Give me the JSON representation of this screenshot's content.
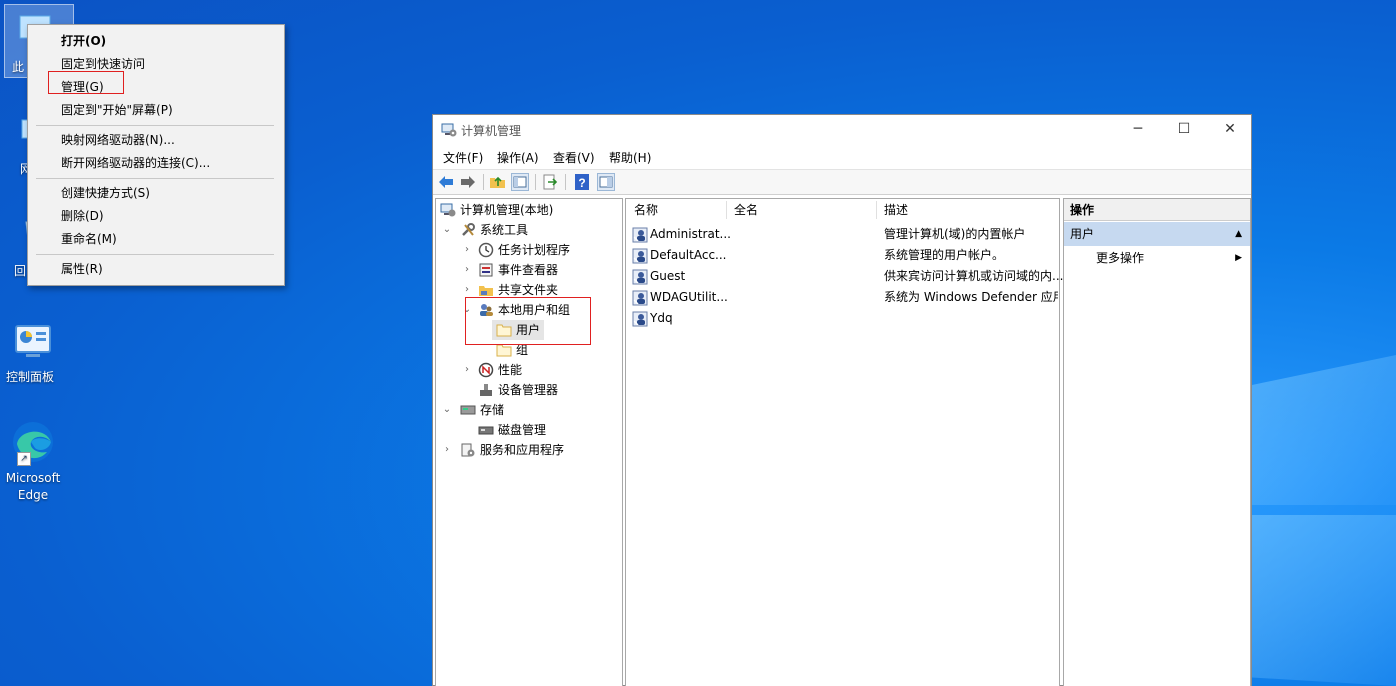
{
  "desktop": {
    "icons": [
      {
        "label": "此"
      },
      {
        "label": "网"
      },
      {
        "label": "回"
      },
      {
        "label": "控制面板"
      },
      {
        "label": "Microsoft Edge"
      }
    ]
  },
  "context_menu": {
    "items": [
      {
        "label": "打开(O)"
      },
      {
        "label": "固定到快速访问"
      },
      {
        "label": "管理(G)"
      },
      {
        "label": "固定到\"开始\"屏幕(P)"
      },
      {
        "label": "映射网络驱动器(N)..."
      },
      {
        "label": "断开网络驱动器的连接(C)..."
      },
      {
        "label": "创建快捷方式(S)"
      },
      {
        "label": "删除(D)"
      },
      {
        "label": "重命名(M)"
      },
      {
        "label": "属性(R)"
      }
    ]
  },
  "window": {
    "title": "计算机管理",
    "menu": [
      "文件(F)",
      "操作(A)",
      "查看(V)",
      "帮助(H)"
    ],
    "tree": [
      {
        "label": "计算机管理(本地)"
      },
      {
        "label": "系统工具"
      },
      {
        "label": "任务计划程序"
      },
      {
        "label": "事件查看器"
      },
      {
        "label": "共享文件夹"
      },
      {
        "label": "本地用户和组"
      },
      {
        "label": "用户"
      },
      {
        "label": "组"
      },
      {
        "label": "性能"
      },
      {
        "label": "设备管理器"
      },
      {
        "label": "存储"
      },
      {
        "label": "磁盘管理"
      },
      {
        "label": "服务和应用程序"
      }
    ],
    "columns": [
      "名称",
      "全名",
      "描述"
    ],
    "rows": [
      {
        "name": "Administrat...",
        "fullname": "",
        "desc": "管理计算机(域)的内置帐户"
      },
      {
        "name": "DefaultAcc...",
        "fullname": "",
        "desc": "系统管理的用户帐户。"
      },
      {
        "name": "Guest",
        "fullname": "",
        "desc": "供来宾访问计算机或访问域的内..."
      },
      {
        "name": "WDAGUtilit...",
        "fullname": "",
        "desc": "系统为 Windows Defender 应用"
      },
      {
        "name": "Ydq",
        "fullname": "",
        "desc": ""
      }
    ],
    "actions": {
      "header": "操作",
      "section": "用户",
      "more": "更多操作"
    }
  },
  "colors": {
    "desktop_blue": "#0b7ae6",
    "highlight_red": "#e02020",
    "action_selected": "#c6d9f0"
  }
}
